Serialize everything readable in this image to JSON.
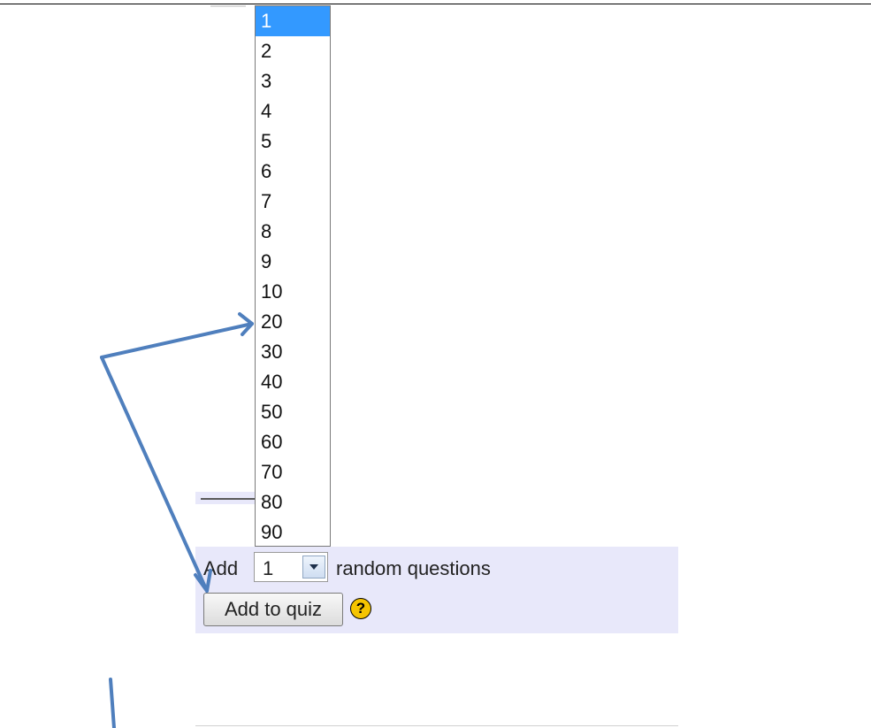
{
  "quiz_panel": {
    "add_label": "Add",
    "count_select": {
      "value": "1"
    },
    "suffix_label": "random questions",
    "add_button_label": "Add to quiz",
    "help_icon": {
      "name": "help-icon",
      "glyph": "?",
      "color": "#f5c400"
    }
  },
  "dropdown": {
    "options": [
      "1",
      "2",
      "3",
      "4",
      "5",
      "6",
      "7",
      "8",
      "9",
      "10",
      "20",
      "30",
      "40",
      "50",
      "60",
      "70",
      "80",
      "90"
    ],
    "selected": "1",
    "highlight_color": "#3399ff"
  },
  "annotation": {
    "arrow_color": "#4f7fbd"
  }
}
